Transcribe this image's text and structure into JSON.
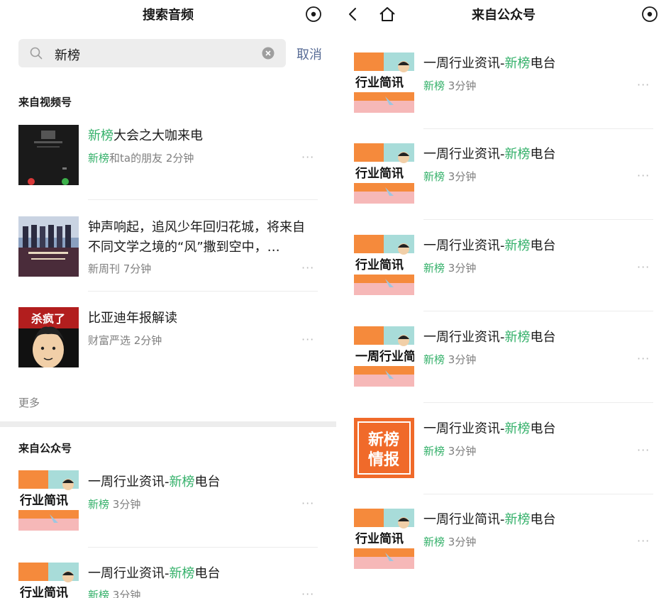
{
  "left": {
    "header": {
      "title": "搜索音频"
    },
    "search": {
      "query": "新榜",
      "cancel_label": "取消"
    },
    "channels": {
      "label": "来自视频号",
      "items": [
        {
          "title_hl": "新榜",
          "title_rest": "大会之大咖来电",
          "meta_hl": "新榜",
          "meta_rest": "和ta的朋友 2分钟"
        },
        {
          "title": "钟声响起，追风少年回归花城，将来自不同文学之境的“风”撒到空中，…",
          "meta": "新周刊 7分钟"
        },
        {
          "title": "比亚迪年报解读",
          "meta": "财富严选 2分钟"
        }
      ],
      "more_label": "更多"
    },
    "accounts": {
      "label": "来自公众号",
      "items": [
        {
          "title_pre": "一周行业资讯-",
          "title_hl": "新榜",
          "title_post": "电台",
          "meta_hl": "新榜",
          "meta_rest": " 3分钟"
        },
        {
          "title_pre": "一周行业资讯-",
          "title_hl": "新榜",
          "title_post": "电台",
          "meta_hl": "新榜",
          "meta_rest": " 3分钟"
        }
      ]
    }
  },
  "right": {
    "header": {
      "title": "来自公众号"
    },
    "items": [
      {
        "title_pre": "一周行业资讯-",
        "title_hl": "新榜",
        "title_post": "电台",
        "meta_hl": "新榜",
        "meta_rest": " 3分钟",
        "thumb_text": "行业简讯"
      },
      {
        "title_pre": "一周行业资讯-",
        "title_hl": "新榜",
        "title_post": "电台",
        "meta_hl": "新榜",
        "meta_rest": " 3分钟",
        "thumb_text": "行业简讯"
      },
      {
        "title_pre": "一周行业资讯-",
        "title_hl": "新榜",
        "title_post": "电台",
        "meta_hl": "新榜",
        "meta_rest": " 3分钟",
        "thumb_text": "行业简讯"
      },
      {
        "title_pre": "一周行业资讯-",
        "title_hl": "新榜",
        "title_post": "电台",
        "meta_hl": "新榜",
        "meta_rest": " 3分钟",
        "thumb_text": "一周行业简"
      },
      {
        "title_pre": "一周行业资讯-",
        "title_hl": "新榜",
        "title_post": "电台",
        "meta_hl": "新榜",
        "meta_rest": " 3分钟",
        "thumb_text": [
          "新榜",
          "情报"
        ]
      },
      {
        "title_pre": "一周行业简讯-",
        "title_hl": "新榜",
        "title_post": "电台",
        "meta_hl": "新榜",
        "meta_rest": " 3分钟",
        "thumb_text": "行业简讯"
      }
    ]
  },
  "thumb_caption": {
    "left_1": "杀疯了"
  },
  "colors": {
    "highlight": "#33b069",
    "cancel": "#576b95",
    "muted": "#7f7f7f",
    "orange": "#f58a3c",
    "teal": "#a8dcd9"
  }
}
